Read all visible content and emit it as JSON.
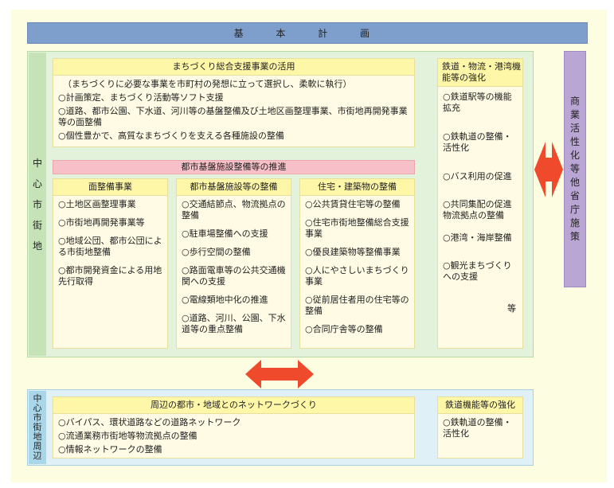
{
  "title": "基　本　計　画",
  "center": {
    "label": "中心市街地",
    "support": {
      "head": "まちづくり総合支援事業の活用",
      "items": [
        "（まちづくりに必要な事業を市町村の発想に立って選択し、柔軟に執行）",
        "○計画策定、まちづくり活動等ソフト支援",
        "○道路、都市公園、下水道、河川等の基盤整備及び土地区画整理事業、市街地再開発事業等の面整備",
        "○個性豊かで、高質なまちづくりを支える各種施設の整備"
      ]
    },
    "infra_bar": "都市基盤施設整備等の推進",
    "columns": [
      {
        "head": "面整備事業",
        "items": [
          "○土地区画整理事業",
          "○市街地再開発事業等",
          "○地域公団、都市公団による市街地整備",
          "○都市開発資金による用地先行取得"
        ]
      },
      {
        "head": "都市基盤施設等の整備",
        "items": [
          "○交通結節点、物流拠点の整備",
          "○駐車場整備への支援",
          "○歩行空間の整備",
          "○路面電車等の公共交通機関への支援",
          "○電線類地中化の推進",
          "○道路、河川、公園、下水道等の重点整備"
        ]
      },
      {
        "head": "住宅・建築物の整備",
        "items": [
          "○公共賃貸住宅等の整備",
          "○住宅市街地整備総合支援事業",
          "○優良建築物等整備事業",
          "○人にやさしいまちづくり事業",
          "○従前居住者用の住宅等の整備",
          "○合同庁舎等の整備"
        ]
      }
    ],
    "rail": {
      "head": "鉄道・物流・港湾機能等の強化",
      "items": [
        "○鉄道駅等の機能拡充",
        "○鉄軌道の整備・活性化",
        "○バス利用の促進",
        "○共同集配の促進 物流拠点の整備",
        "○港湾・海岸整備",
        "○観光まちづくりへの支援"
      ],
      "etc": "等"
    }
  },
  "side": {
    "label": "商業活性化等他省庁施策"
  },
  "periphery": {
    "label": "中心市街地周辺",
    "network": {
      "head": "周辺の都市・地域とのネットワークづくり",
      "items": [
        "○バイパス、環状道路などの道路ネットワーク",
        "○流通業務市街地等物流拠点の整備",
        "○情報ネットワークの整備"
      ]
    },
    "rail": {
      "head": "鉄道機能等の強化",
      "items": [
        "○鉄軌道の整備・活性化"
      ]
    }
  },
  "colors": {
    "arrow": "#ef4a2b",
    "title_bar": "#7e9fcb",
    "center_bg": "#e3f2da",
    "periphery_bg": "#dff0f6",
    "side_bar": "#b9a6d4",
    "pink_bar": "#f7c0c8",
    "box_head": "#fff7a8"
  }
}
